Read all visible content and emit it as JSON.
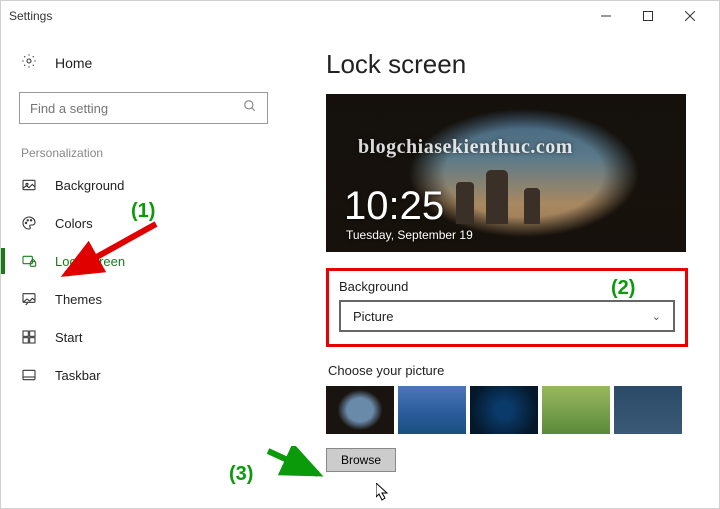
{
  "window": {
    "title": "Settings"
  },
  "sidebar": {
    "home": "Home",
    "search_placeholder": "Find a setting",
    "section": "Personalization",
    "items": [
      {
        "label": "Background"
      },
      {
        "label": "Colors"
      },
      {
        "label": "Lock screen"
      },
      {
        "label": "Themes"
      },
      {
        "label": "Start"
      },
      {
        "label": "Taskbar"
      }
    ]
  },
  "main": {
    "heading": "Lock screen",
    "preview": {
      "time": "10:25",
      "date": "Tuesday, September 19",
      "watermark": "blogchiasekienthuc.com"
    },
    "background_label": "Background",
    "background_value": "Picture",
    "choose_label": "Choose your picture",
    "browse": "Browse"
  },
  "annotations": {
    "a1": "(1)",
    "a2": "(2)",
    "a3": "(3)"
  }
}
